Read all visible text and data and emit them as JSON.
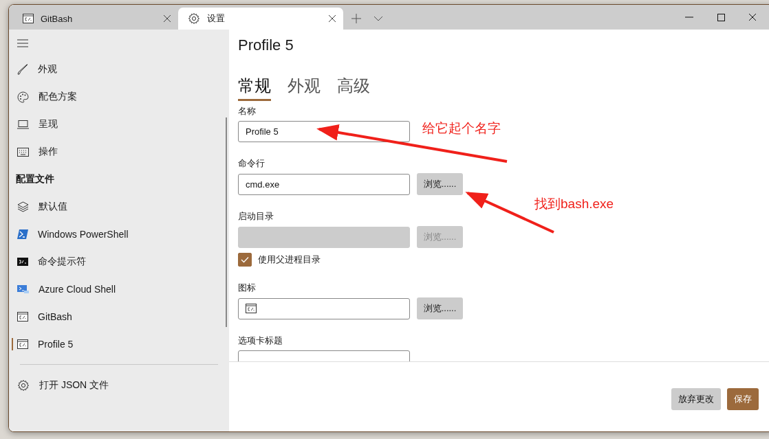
{
  "tabs": [
    {
      "title": "GitBash",
      "selected": false
    },
    {
      "title": "设置",
      "selected": true
    }
  ],
  "sidebar": {
    "items": [
      {
        "label": "外观",
        "selected": false
      },
      {
        "label": "配色方案",
        "selected": false
      },
      {
        "label": "呈现",
        "selected": false
      },
      {
        "label": "操作",
        "selected": false
      }
    ],
    "profiles_heading": "配置文件",
    "profiles": [
      {
        "label": "默认值",
        "selected": false
      },
      {
        "label": "Windows PowerShell",
        "selected": false
      },
      {
        "label": "命令提示符",
        "selected": false
      },
      {
        "label": "Azure Cloud Shell",
        "selected": false
      },
      {
        "label": "GitBash",
        "selected": false
      },
      {
        "label": "Profile 5",
        "selected": true
      }
    ],
    "footer": "打开 JSON 文件"
  },
  "page_title": "Profile 5",
  "pivots": [
    {
      "label": "常规",
      "selected": true
    },
    {
      "label": "外观",
      "selected": false
    },
    {
      "label": "高级",
      "selected": false
    }
  ],
  "fields": [
    {
      "kind": "text",
      "label": "名称",
      "value": "Profile 5"
    },
    {
      "kind": "browse",
      "label": "命令行",
      "value": "cmd.exe",
      "button": "浏览......",
      "disabled": false
    },
    {
      "kind": "browse",
      "label": "启动目录",
      "button": "浏览......",
      "disabled": true,
      "checkbox": {
        "label": "使用父进程目录",
        "checked": true
      }
    },
    {
      "kind": "icon",
      "label": "图标",
      "button": "浏览......",
      "disabled": false
    },
    {
      "kind": "text",
      "label": "选项卡标题"
    }
  ],
  "buttons": [
    {
      "label": "放弃更改",
      "kind": "secondary"
    },
    {
      "label": "保存",
      "kind": "primary"
    }
  ],
  "annotations": [
    {
      "text": "给它起个名字"
    },
    {
      "text": "找到bash.exe"
    }
  ]
}
